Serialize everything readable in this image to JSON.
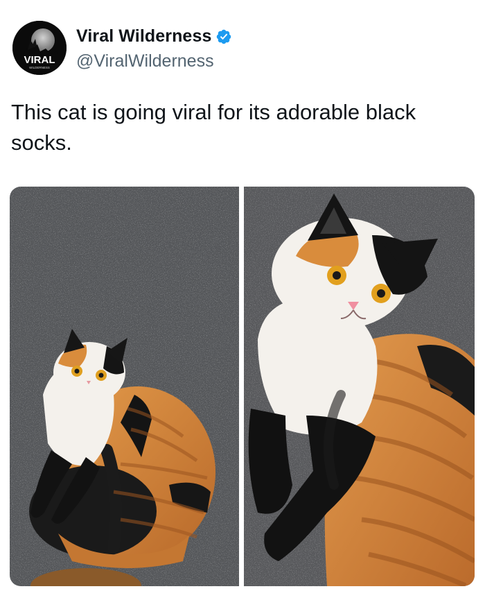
{
  "post": {
    "author": {
      "display_name": "Viral Wilderness",
      "handle": "@ViralWilderness",
      "verified": true,
      "avatar_text": "VIRAL",
      "avatar_subtext": "WILDERNESS",
      "avatar_icon": "wolf-howling-moon-logo"
    },
    "text": "This cat is going viral for its adorable black socks.",
    "media": [
      {
        "name": "photo-1",
        "alt_icon": "calico-cat-curled-on-asphalt"
      },
      {
        "name": "photo-2",
        "alt_icon": "calico-cat-closeup-on-asphalt"
      }
    ]
  },
  "colors": {
    "text": "#0f1419",
    "secondary_text": "#536471",
    "verified_blue": "#1d9bf0",
    "asphalt": "#55575a",
    "cat_orange": "#d68a3c",
    "cat_black": "#161616",
    "cat_white": "#f4f1ec"
  }
}
